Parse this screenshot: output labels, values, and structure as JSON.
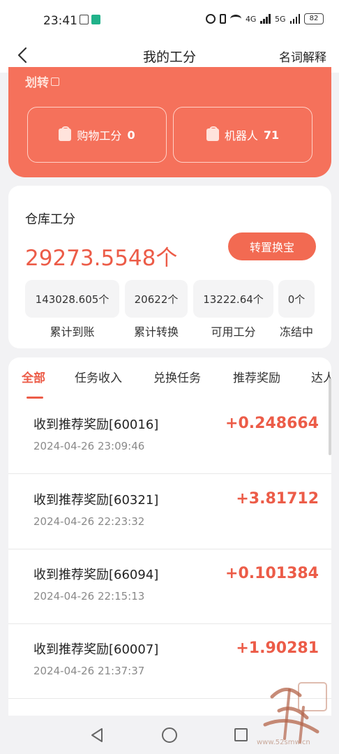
{
  "status_bar": {
    "time": "23:41",
    "network_1": "4G",
    "network_2": "5G",
    "battery": "82"
  },
  "header": {
    "title": "我的工分",
    "right_link": "名词解释"
  },
  "top_card": {
    "transfer_label": "划转",
    "shopping": {
      "label": "购物工分",
      "value": "0"
    },
    "robot": {
      "label": "机器人",
      "value": "71"
    }
  },
  "warehouse": {
    "title": "仓库工分",
    "value": "29273.5548个",
    "action_label": "转置换宝",
    "stats": [
      {
        "value": "143028.605个",
        "label": "累计到账"
      },
      {
        "value": "20622个",
        "label": "累计转换"
      },
      {
        "value": "13222.64个",
        "label": "可用工分"
      },
      {
        "value": "0个",
        "label": "冻结中"
      }
    ]
  },
  "tabs": [
    "全部",
    "任务收入",
    "兑换任务",
    "推荐奖励",
    "达人"
  ],
  "records": [
    {
      "title": "收到推荐奖励[60016]",
      "date": "2024-04-26 23:09:46",
      "amount": "+0.248664"
    },
    {
      "title": "收到推荐奖励[60321]",
      "date": "2024-04-26 22:23:32",
      "amount": "+3.81712"
    },
    {
      "title": "收到推荐奖励[66094]",
      "date": "2024-04-26 22:15:13",
      "amount": "+0.101384"
    },
    {
      "title": "收到推荐奖励[60007]",
      "date": "2024-04-26 21:37:37",
      "amount": "+1.90281"
    }
  ],
  "watermark": {
    "text": "吾爱首码",
    "url": "www.52smw.cn"
  },
  "colors": {
    "accent": "#ec5c48",
    "orange_card": "#f5715b",
    "button": "#f26a52"
  }
}
